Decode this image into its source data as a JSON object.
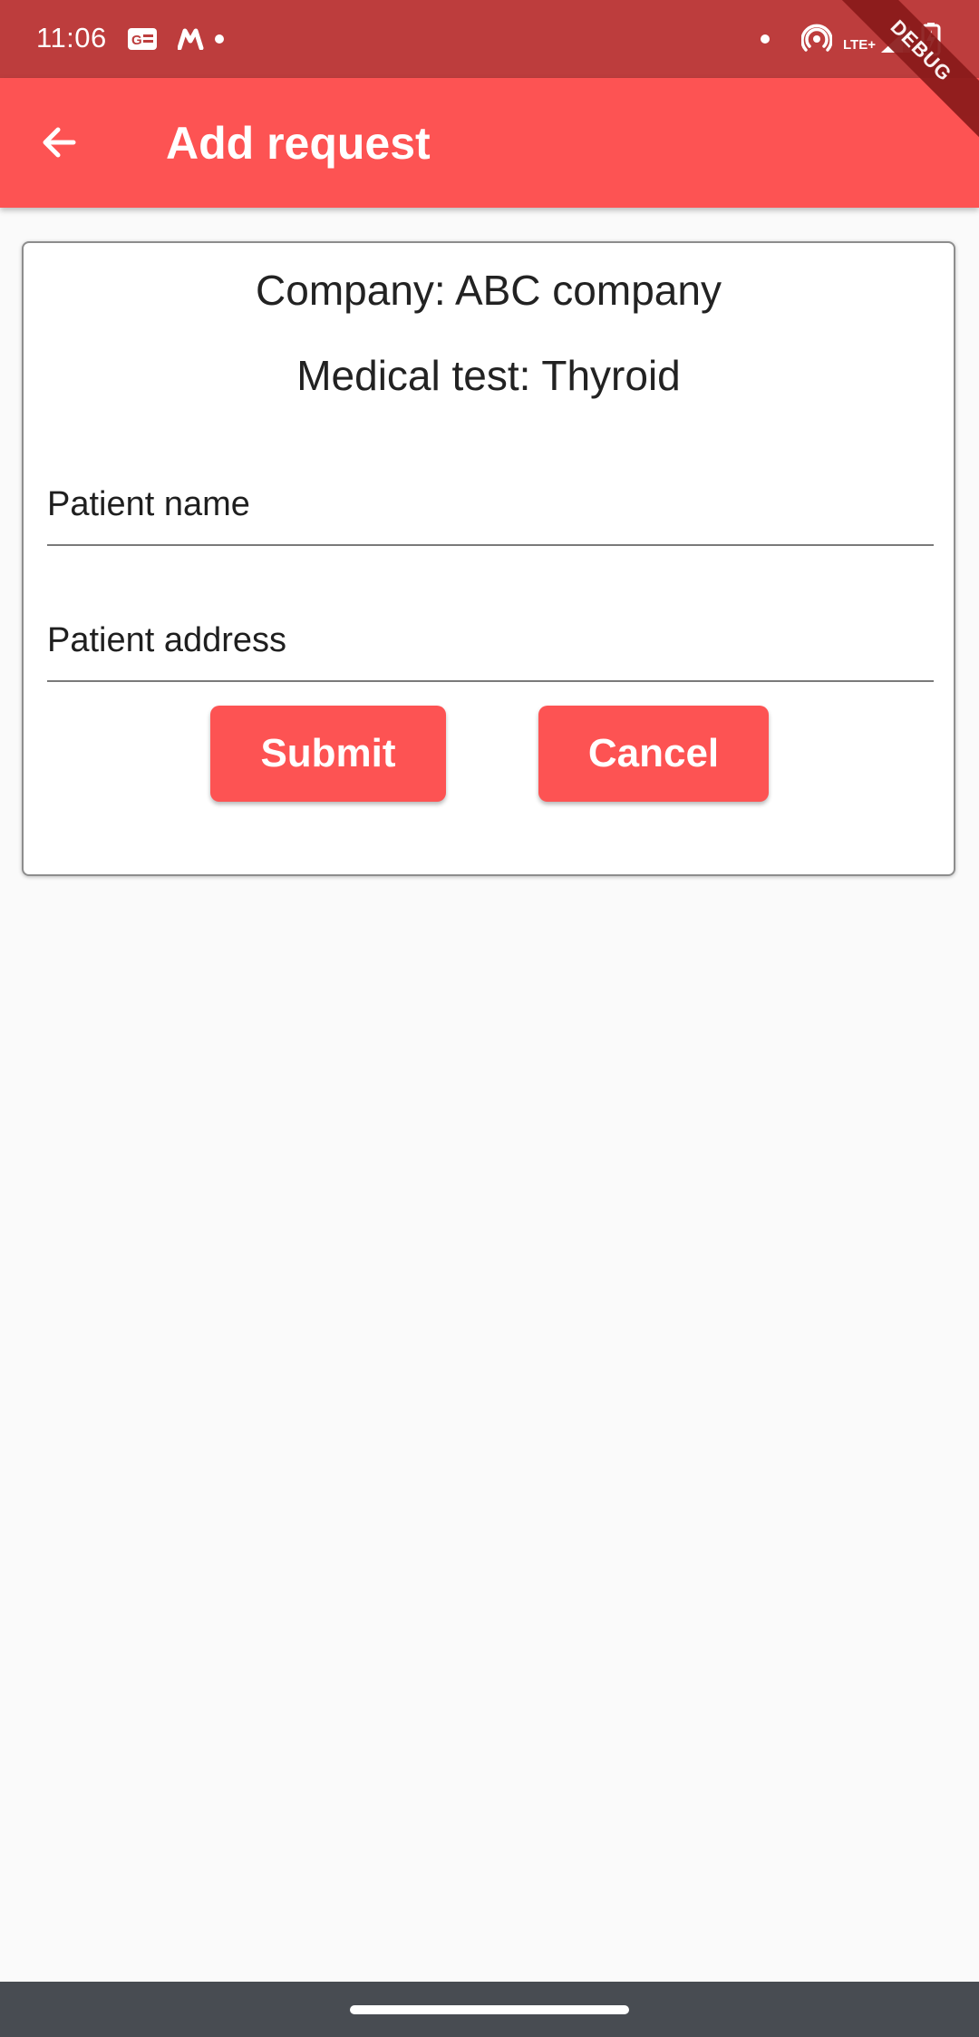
{
  "status_bar": {
    "time": "11:06",
    "network_label": "LTE+",
    "icons": [
      "news-icon",
      "messaging-app-icon",
      "notification-dot-icon",
      "hotspot-icon",
      "signal-icon",
      "battery-charging-icon"
    ]
  },
  "debug_banner": "DEBUG",
  "app_bar": {
    "title": "Add request",
    "back_icon": "arrow-left-icon"
  },
  "card": {
    "company_line": "Company: ABC company",
    "test_line": "Medical test: Thyroid",
    "patient_name": {
      "placeholder": "Patient name",
      "value": ""
    },
    "patient_address": {
      "placeholder": "Patient address",
      "value": ""
    },
    "submit_label": "Submit",
    "cancel_label": "Cancel"
  },
  "colors": {
    "status_bar": "#bd3d3d",
    "app_bar": "#fd5353",
    "button": "#fd5353",
    "background": "#fafafa",
    "nav_bar": "#484c52"
  }
}
